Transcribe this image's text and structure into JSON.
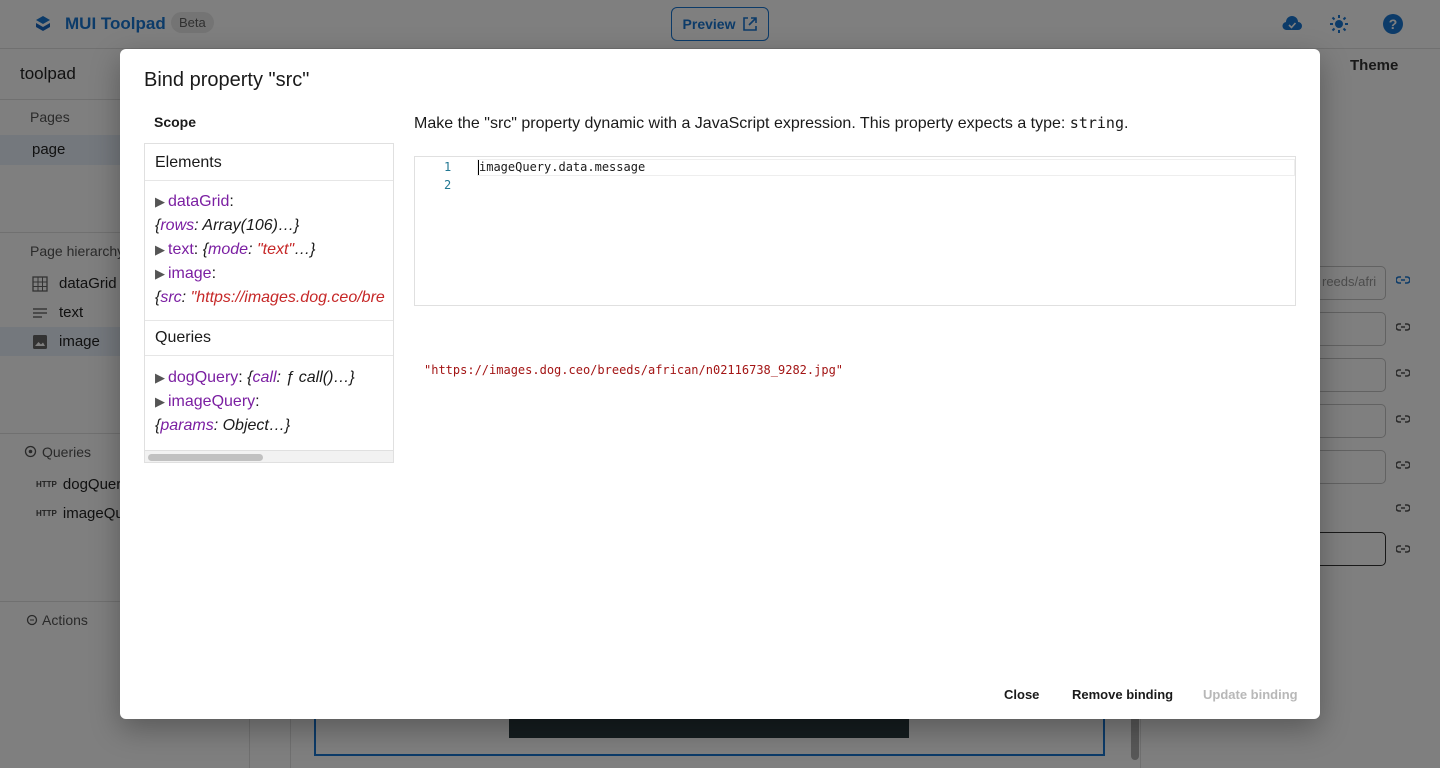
{
  "app": {
    "brand": "MUI Toolpad",
    "beta": "Beta",
    "preview": "Preview",
    "app_name": "toolpad",
    "colors": {
      "primary": "#1976d2",
      "backdrop": "rgba(0,0,0,0.5)"
    }
  },
  "left_panel": {
    "pages_label": "Pages",
    "pages": [
      "page"
    ],
    "hierarchy_label": "Page hierarchy",
    "hierarchy": [
      {
        "label": "dataGrid",
        "icon": "grid-icon"
      },
      {
        "label": "text",
        "icon": "text-lines-icon"
      },
      {
        "label": "image",
        "icon": "image-icon"
      }
    ],
    "queries_label": "Queries",
    "queries": [
      {
        "tag": "HTTP",
        "label": "dogQuer"
      },
      {
        "tag": "HTTP",
        "label": "imageQu"
      }
    ],
    "actions_label": "Actions"
  },
  "right_panel": {
    "theme_tab": "Theme",
    "src_field_partial": "reeds/afri"
  },
  "dialog": {
    "title": "Bind property \"src\"",
    "scope_title": "Scope",
    "elements_title": "Elements",
    "elements": {
      "dataGrid": {
        "name": "dataGrid",
        "key": "rows",
        "value": "Array(106)"
      },
      "text": {
        "name": "text",
        "key": "mode",
        "value": "\"text\""
      },
      "image": {
        "name": "image",
        "key": "src",
        "value": "\"https://images.dog.ceo/bre"
      }
    },
    "queries_title": "Queries",
    "queries": {
      "dogQuery": {
        "name": "dogQuery",
        "key": "call",
        "value": "ƒ call()"
      },
      "imageQuery": {
        "name": "imageQuery",
        "key": "params",
        "value": "Object"
      }
    },
    "description_prefix": "Make the \"src\" property dynamic with a JavaScript expression. This property expects a type: ",
    "description_type": "string",
    "description_suffix": ".",
    "editor": {
      "line_numbers": [
        "1",
        "2"
      ],
      "code": "imageQuery.data.message"
    },
    "result": "\"https://images.dog.ceo/breeds/african/n02116738_9282.jpg\"",
    "buttons": {
      "close": "Close",
      "remove": "Remove binding",
      "update": "Update binding"
    }
  }
}
